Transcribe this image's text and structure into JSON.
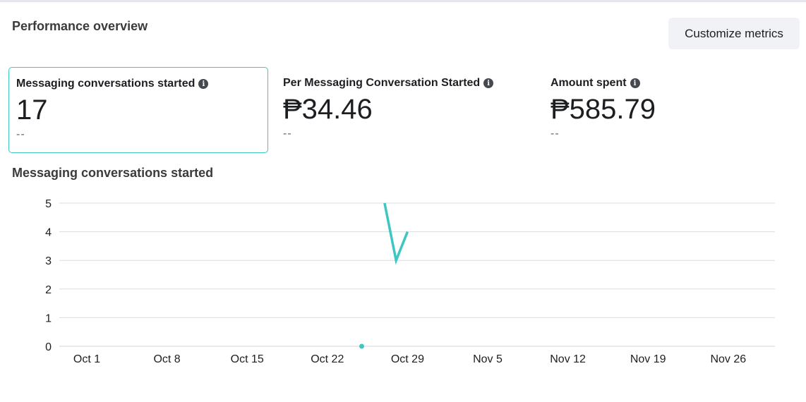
{
  "header": {
    "title": "Performance overview",
    "customize_label": "Customize metrics"
  },
  "metrics": [
    {
      "label": "Messaging conversations started",
      "value": "17",
      "compare": "--",
      "selected": true
    },
    {
      "label": "Per Messaging Conversation Started",
      "value": "₱34.46",
      "compare": "--",
      "selected": false
    },
    {
      "label": "Amount spent",
      "value": "₱585.79",
      "compare": "--",
      "selected": false
    }
  ],
  "colors": {
    "accent": "#3ec6c2",
    "grid": "#dadde1"
  },
  "chart_data": {
    "type": "line",
    "title": "Messaging conversations started",
    "ylim": [
      0,
      5
    ],
    "yticks": [
      0,
      1,
      2,
      3,
      4,
      5
    ],
    "x_tick_labels": [
      "Oct 1",
      "Oct 8",
      "Oct 15",
      "Oct 22",
      "Oct 29",
      "Nov 5",
      "Nov 12",
      "Nov 19",
      "Nov 26"
    ],
    "series": [
      {
        "points": [
          {
            "x": "2023-10-25",
            "y": 0
          },
          {
            "x": "2023-10-27",
            "y": 5
          },
          {
            "x": "2023-10-28",
            "y": 3
          },
          {
            "x": "2023-10-29",
            "y": 4
          }
        ]
      }
    ]
  }
}
